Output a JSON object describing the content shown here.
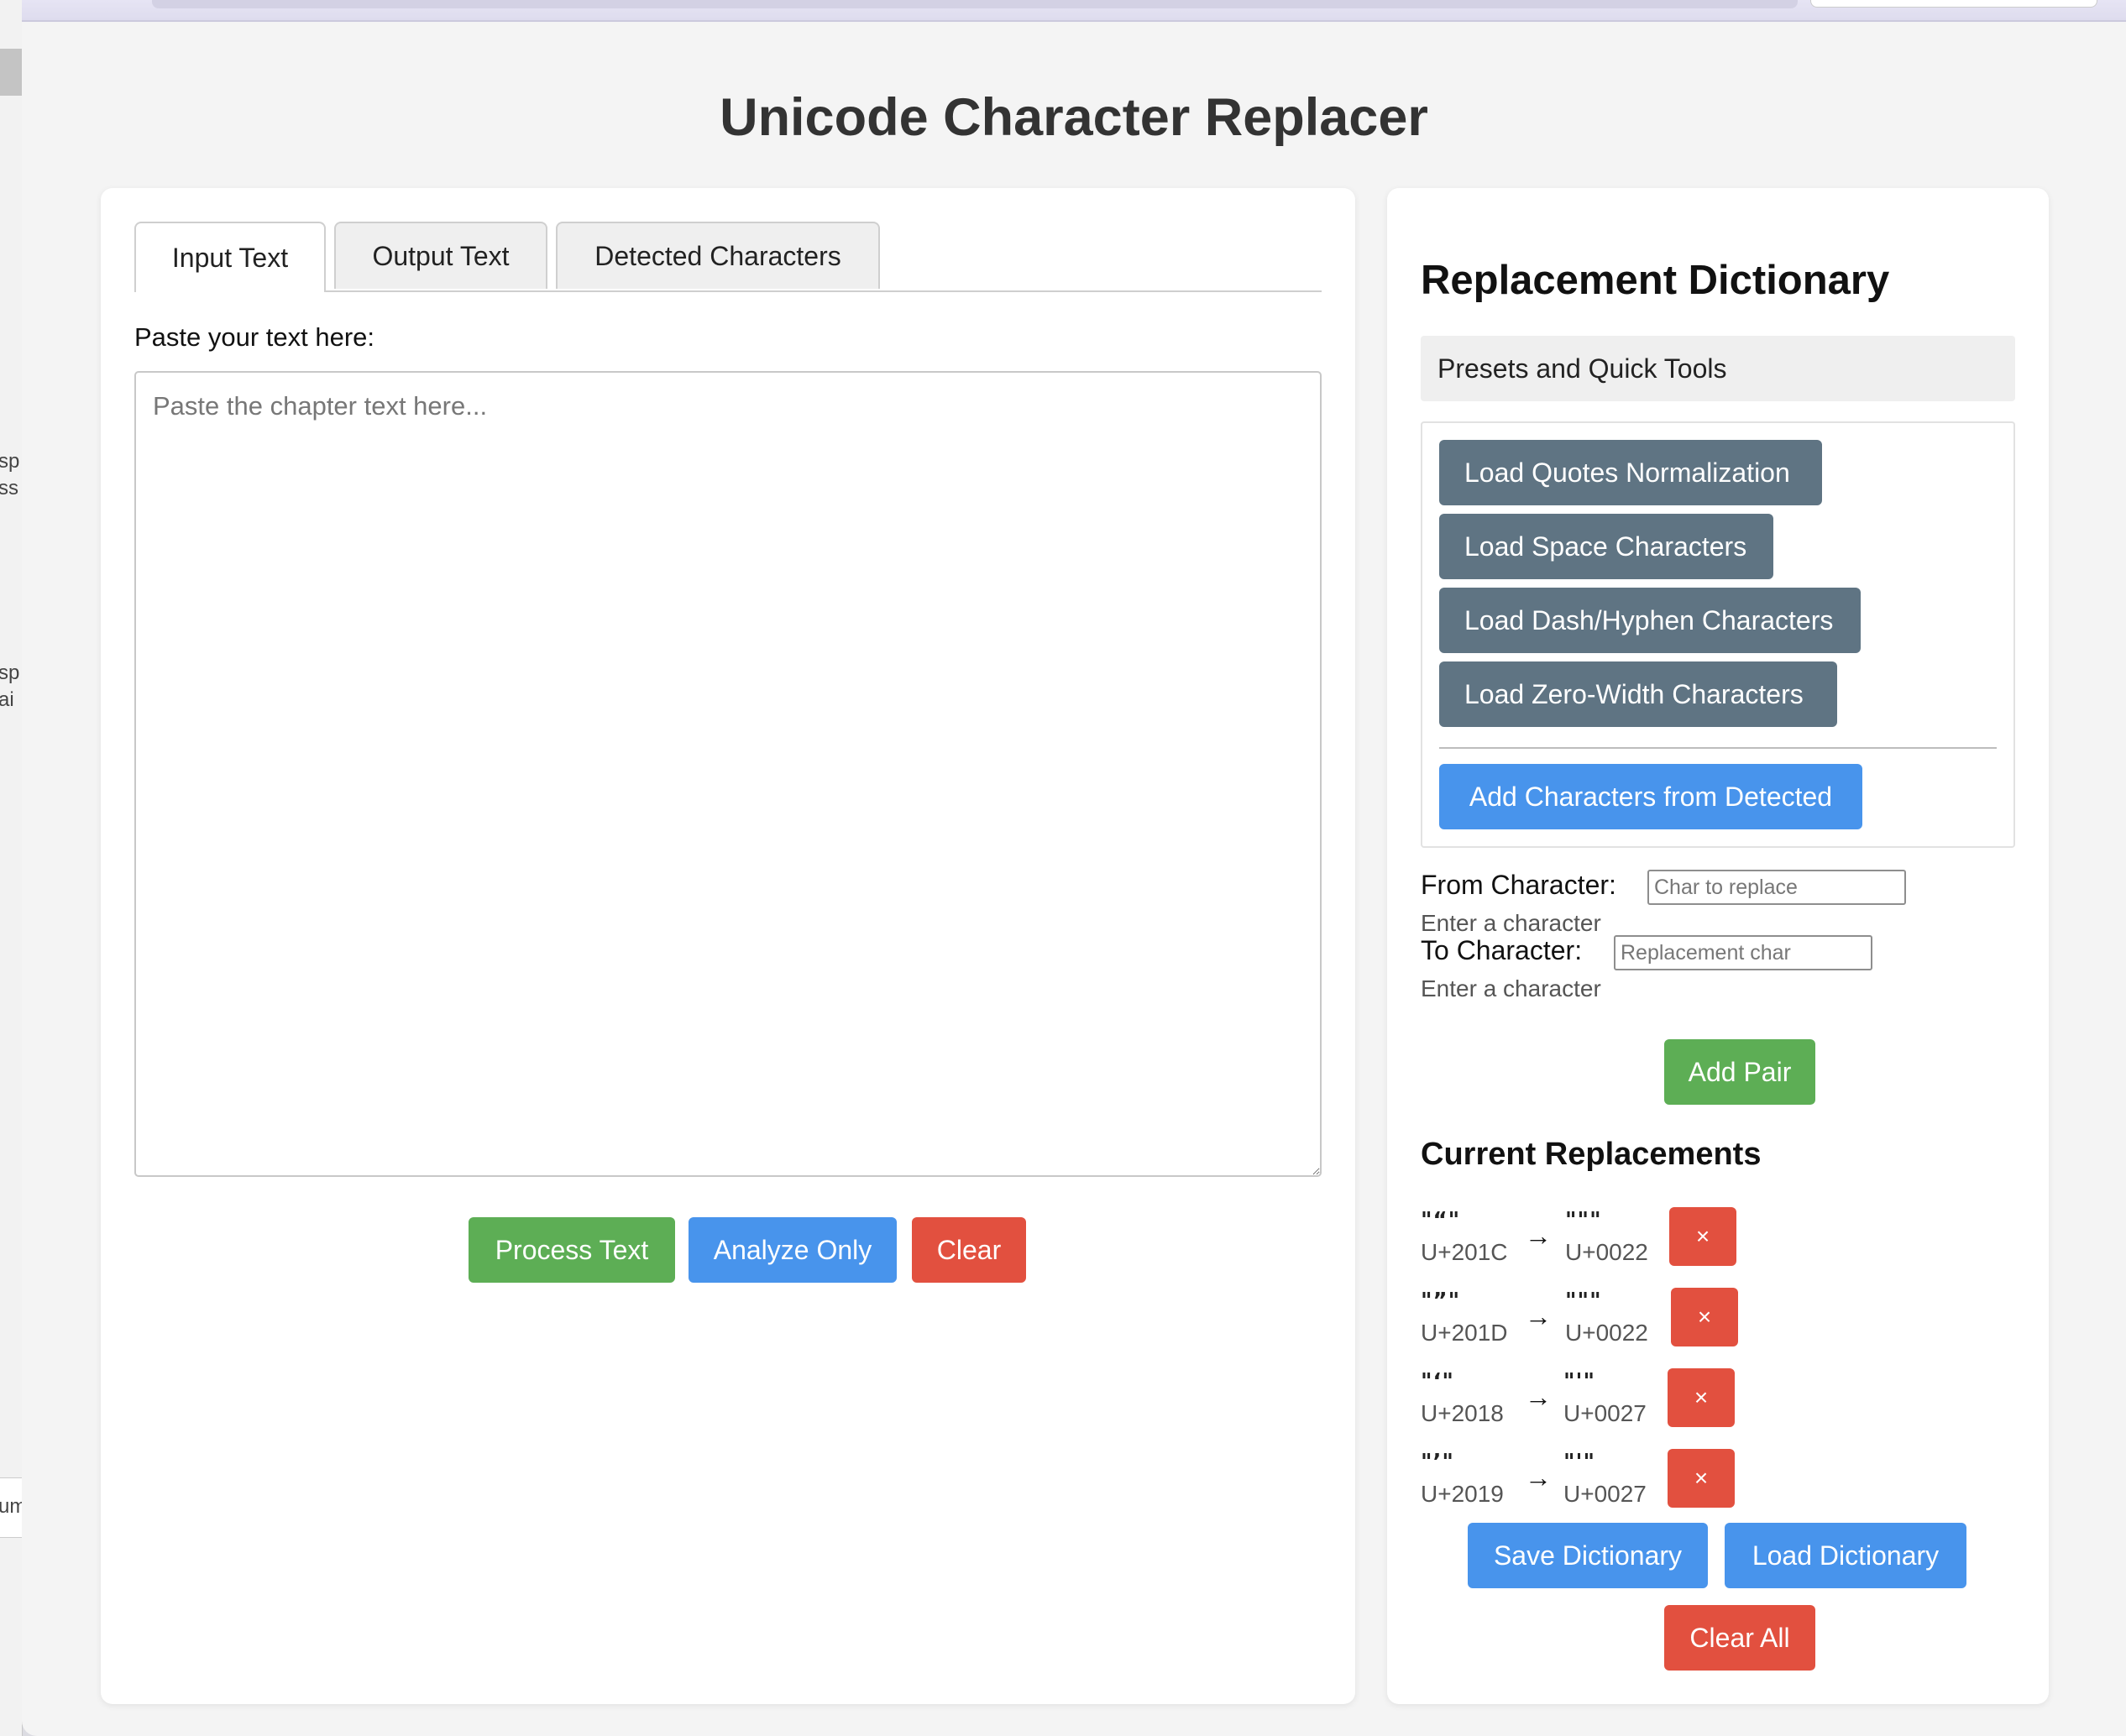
{
  "app": {
    "title": "Unicode Character Replacer"
  },
  "tabs": [
    {
      "label": "Input Text",
      "active": true
    },
    {
      "label": "Output Text",
      "active": false
    },
    {
      "label": "Detected Characters",
      "active": false
    }
  ],
  "input": {
    "label": "Paste your text here:",
    "placeholder": "Paste the chapter text here...",
    "value": ""
  },
  "actions": {
    "process_label": "Process Text",
    "analyze_label": "Analyze Only",
    "clear_label": "Clear"
  },
  "dictionary": {
    "title": "Replacement Dictionary",
    "presets_heading": "Presets and Quick Tools",
    "presets": [
      "Load Quotes Normalization",
      "Load Space Characters",
      "Load Dash/Hyphen Characters",
      "Load Zero-Width Characters"
    ],
    "add_detected_label": "Add Characters from Detected",
    "from": {
      "label": "From Character:",
      "placeholder": "Char to replace",
      "hint": "Enter a character"
    },
    "to": {
      "label": "To Character:",
      "placeholder": "Replacement char",
      "hint": "Enter a character"
    },
    "add_pair_label": "Add Pair",
    "current_title": "Current Replacements",
    "replacements": [
      {
        "from_char": "\"“\"",
        "from_code": "U+201C",
        "arrow": "→",
        "to_char": "\"\"\"",
        "to_code": "U+0022",
        "delete": "×"
      },
      {
        "from_char": "\"”\"",
        "from_code": "U+201D",
        "arrow": "→",
        "to_char": "\"\"\"",
        "to_code": "U+0022",
        "delete": "×"
      },
      {
        "from_char": "\"‘\"",
        "from_code": "U+2018",
        "arrow": "→",
        "to_char": "\"'\"",
        "to_code": "U+0027",
        "delete": "×"
      },
      {
        "from_char": "\"’\"",
        "from_code": "U+2019",
        "arrow": "→",
        "to_char": "\"'\"",
        "to_code": "U+0027",
        "delete": "×"
      }
    ],
    "save_label": "Save Dictionary",
    "load_label": "Load Dictionary",
    "clear_all_label": "Clear All"
  },
  "background_window": {
    "fragments": [
      "sp",
      "ss",
      "sp",
      "ai",
      "um"
    ]
  },
  "colors": {
    "green": "#5dae55",
    "blue": "#4894ec",
    "red": "#e2503f",
    "slate": "#5f7483"
  }
}
